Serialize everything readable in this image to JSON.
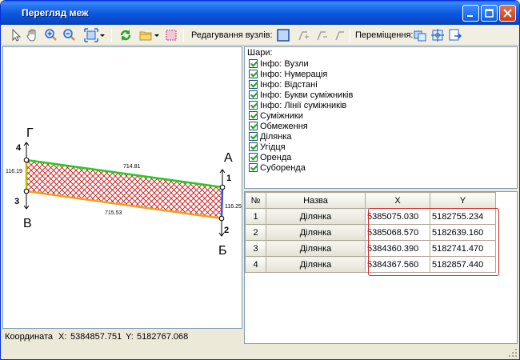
{
  "window": {
    "title": "Перегляд меж"
  },
  "toolbar": {
    "edit_nodes_label": "Редагування вузлів:",
    "move_label": "Переміщення:"
  },
  "drawing": {
    "corners": [
      {
        "number": "4",
        "letter": "Г"
      },
      {
        "number": "3",
        "letter": "В"
      },
      {
        "number": "1",
        "letter": "А"
      },
      {
        "number": "2",
        "letter": "Б"
      }
    ],
    "edges": [
      {
        "length": "714.81",
        "color": "#22cc22"
      },
      {
        "length": "715.53",
        "color": "#f0a020"
      },
      {
        "length": "116.19",
        "color": "#c8b400"
      },
      {
        "length": "116.25",
        "color": "#3a5ad8"
      }
    ],
    "fill_color": "#cc1010"
  },
  "status": {
    "coord_label": "Координата",
    "x_label": "X:",
    "x_value": "5384857.751",
    "y_label": "Y:",
    "y_value": "5182767.068"
  },
  "layers": {
    "title": "Шари:",
    "items": [
      {
        "label": "Інфо: Вузли",
        "checked": true
      },
      {
        "label": "Інфо: Нумерація",
        "checked": true
      },
      {
        "label": "Інфо: Відстані",
        "checked": true
      },
      {
        "label": "Інфо: Букви суміжників",
        "checked": true
      },
      {
        "label": "Інфо: Лінії суміжників",
        "checked": true
      },
      {
        "label": "Суміжники",
        "checked": true
      },
      {
        "label": "Обмеження",
        "checked": true
      },
      {
        "label": "Ділянка",
        "checked": true
      },
      {
        "label": "Угідця",
        "checked": true
      },
      {
        "label": "Оренда",
        "checked": true
      },
      {
        "label": "Суборенда",
        "checked": true
      }
    ]
  },
  "grid": {
    "headers": [
      "№",
      "Назва",
      "X",
      "Y"
    ],
    "rows": [
      {
        "n": "1",
        "name": "Ділянка",
        "x": "5385075.030",
        "y": "5182755.234"
      },
      {
        "n": "2",
        "name": "Ділянка",
        "x": "5385068.570",
        "y": "5182639.160"
      },
      {
        "n": "3",
        "name": "Ділянка",
        "x": "5384360.390",
        "y": "5182741.470"
      },
      {
        "n": "4",
        "name": "Ділянка",
        "x": "5384367.560",
        "y": "5182857.440"
      }
    ]
  }
}
